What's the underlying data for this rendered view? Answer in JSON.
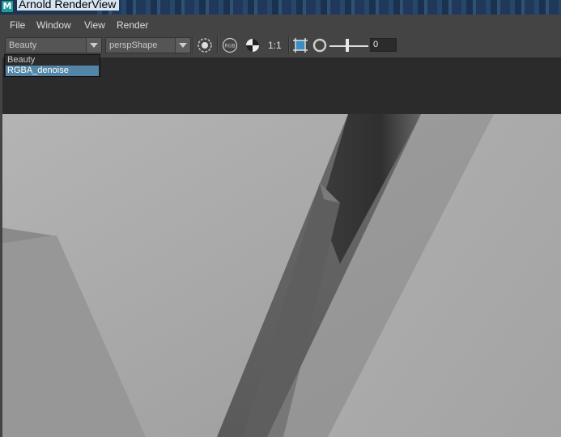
{
  "window": {
    "title": "Arnold RenderView",
    "app_icon": "M"
  },
  "menu": [
    "File",
    "Window",
    "View",
    "Render"
  ],
  "toolbar": {
    "aov_selected": "Beauty",
    "camera_selected": "perspShape",
    "rgb_label": "RGB",
    "ratio_label": "1:1",
    "exposure_value": "0"
  },
  "aov_menu": {
    "options": [
      "Beauty",
      "RGBA_denoise"
    ],
    "highlighted": "RGBA_denoise"
  },
  "colors": {
    "highlight": "#5285a6",
    "background": "#444444",
    "panel": "#2b2b2b"
  }
}
